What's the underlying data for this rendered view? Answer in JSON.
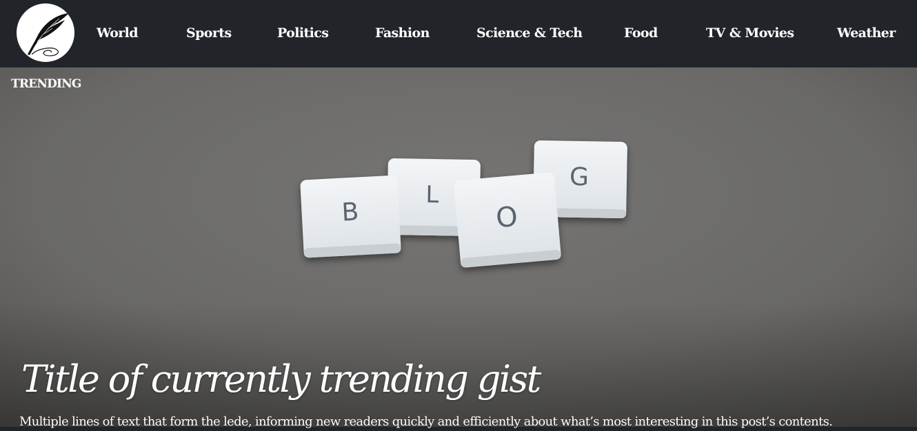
{
  "nav": {
    "logo": {
      "icon": "quill-pen-icon"
    },
    "links": [
      {
        "label": "World"
      },
      {
        "label": "Sports"
      },
      {
        "label": "Politics"
      },
      {
        "label": "Fashion"
      },
      {
        "label": "Science & Tech"
      },
      {
        "label": "Food"
      },
      {
        "label": "TV & Movies"
      },
      {
        "label": "Weather"
      }
    ]
  },
  "hero": {
    "section_label": "TRENDING",
    "image": {
      "subject": "blog-letter-tiles-photo",
      "tiles": [
        "B",
        "L",
        "O",
        "G"
      ]
    },
    "title": "Title of currently trending gist",
    "lede": "Multiple lines of text that form the lede, informing new readers quickly and efficiently about what’s most interesting in this post’s contents."
  },
  "colors": {
    "navbar": "#212529",
    "nav_text": "#ffffff",
    "hero_background": "#6d6c6a",
    "tile": "#eef1f4",
    "tile_letter": "#5a6470"
  }
}
